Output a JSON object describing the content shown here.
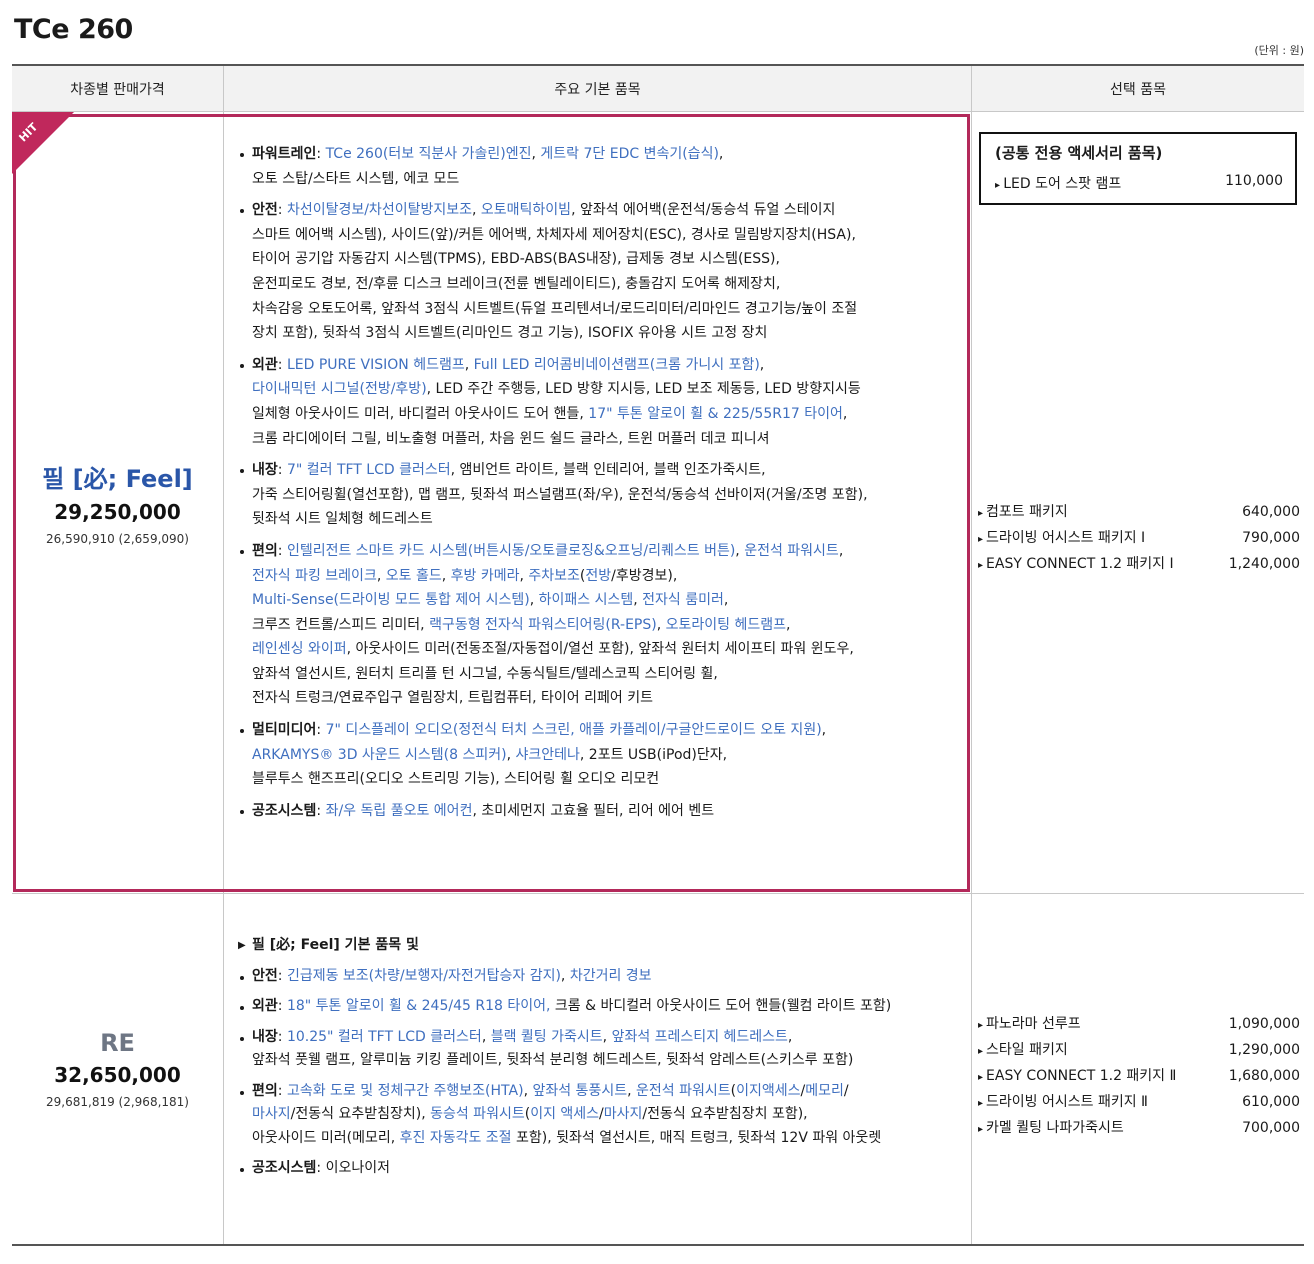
{
  "title": "TCe 260",
  "unit": "(단위 : 원)",
  "headers": [
    "차종별 판매가격",
    "주요 기본 품목",
    "선택 품목"
  ],
  "hit_label": "HIT",
  "trims": [
    {
      "name": "필 [必; Feel]",
      "price": "29,250,000",
      "sub": "26,590,910 (2,659,090)",
      "accessory": {
        "title": "(공통 전용 액세서리 품목)",
        "item": "LED 도어 스팟 램프",
        "price": "110,000"
      },
      "features": [
        {
          "label": "파워트레인",
          "segs": [
            [
              ": ",
              0
            ],
            [
              "TCe 260(터보 직분사 가솔린)엔진",
              1
            ],
            [
              ", ",
              0
            ],
            [
              "게트락 7단 EDC 변속기(습식)",
              1
            ],
            [
              ",",
              0
            ],
            [
              "\n오토 스탑/스타트 시스템, 에코 모드",
              0
            ]
          ]
        },
        {
          "label": "안전",
          "segs": [
            [
              ": ",
              0
            ],
            [
              "차선이탈경보/차선이탈방지보조",
              1
            ],
            [
              ", ",
              0
            ],
            [
              "오토매틱하이빔",
              1
            ],
            [
              ", 앞좌석 에어백(운전석/동승석 듀얼 스테이지\n스마트 에어백 시스템), 사이드(앞)/커튼 에어백, 차체자세 제어장치(ESC), 경사로 밀림방지장치(HSA),\n타이어 공기압 자동감지 시스템(TPMS), EBD-ABS(BAS내장), 급제동 경보 시스템(ESS),\n운전피로도 경보, 전/후륜 디스크 브레이크(전륜 벤틸레이티드), 충돌감지 도어록 해제장치,\n차속감응 오토도어록, 앞좌석 3점식 시트벨트(듀얼 프리텐셔너/로드리미터/리마인드 경고기능/높이 조절\n장치 포함), 뒷좌석 3점식 시트벨트(리마인드 경고 기능), ISOFIX 유아용 시트 고정 장치",
              0
            ]
          ]
        },
        {
          "label": "외관",
          "segs": [
            [
              ": ",
              0
            ],
            [
              "LED PURE VISION  헤드램프",
              1
            ],
            [
              ", ",
              0
            ],
            [
              "Full LED 리어콤비네이션램프(크롬 가니시 포함)",
              1
            ],
            [
              ",\n",
              0
            ],
            [
              "다이내믹턴 시그널(전방/후방)",
              1
            ],
            [
              ", LED 주간 주행등, LED 방향 지시등, LED 보조 제동등, LED 방향지시등\n일체형 아웃사이드 미러, 바디컬러 아웃사이드 도어 핸들, ",
              0
            ],
            [
              "17\" 투톤 알로이 휠 & 225/55R17 타이어",
              1
            ],
            [
              ",\n크롬 라디에이터 그릴, 비노출형 머플러, 차음 윈드 쉴드 글라스, 트윈 머플러 데코 피니셔",
              0
            ]
          ]
        },
        {
          "label": "내장",
          "segs": [
            [
              ": ",
              0
            ],
            [
              "7\" 컬러 TFT LCD 클러스터",
              1
            ],
            [
              ", 앰비언트 라이트, 블랙 인테리어, 블랙 인조가죽시트,\n가죽 스티어링휠(열선포함), 맵 램프, 뒷좌석 퍼스널램프(좌/우), 운전석/동승석 선바이저(거울/조명 포함),\n뒷좌석 시트 일체형 헤드레스트",
              0
            ]
          ]
        },
        {
          "label": "편의",
          "segs": [
            [
              ": ",
              0
            ],
            [
              "인텔리전트 스마트 카드 시스템(버튼시동/오토클로징&오프닝/리퀘스트 버튼)",
              1
            ],
            [
              ", ",
              0
            ],
            [
              "운전석 파워시트",
              1
            ],
            [
              ",\n",
              0
            ],
            [
              "전자식 파킹 브레이크",
              1
            ],
            [
              ", ",
              0
            ],
            [
              "오토 홀드",
              1
            ],
            [
              ", ",
              0
            ],
            [
              "후방 카메라",
              1
            ],
            [
              ", ",
              0
            ],
            [
              "주차보조",
              1
            ],
            [
              "(",
              0
            ],
            [
              "전방",
              1
            ],
            [
              "/후방경보),\n",
              0
            ],
            [
              "Multi-Sense(드라이빙 모드 통합 제어 시스템)",
              1
            ],
            [
              ", ",
              0
            ],
            [
              "하이패스 시스템",
              1
            ],
            [
              ", ",
              0
            ],
            [
              "전자식 룸미러",
              1
            ],
            [
              ",\n크루즈 컨트롤/스피드 리미터, ",
              0
            ],
            [
              "랙구동형 전자식 파워스티어링(R-EPS)",
              1
            ],
            [
              ", ",
              0
            ],
            [
              "오토라이팅 헤드램프",
              1
            ],
            [
              ",\n",
              0
            ],
            [
              "레인센싱 와이퍼",
              1
            ],
            [
              ", 아웃사이드 미러(전동조절/자동접이/열선 포함), 앞좌석 원터치 세이프티 파워 윈도우,\n앞좌석 열선시트, 원터치 트리플 턴 시그널, 수동식틸트/텔레스코픽 스티어링 휠,\n전자식 트렁크/연료주입구 열림장치, 트립컴퓨터, 타이어 리페어 키트",
              0
            ]
          ]
        },
        {
          "label": "멀티미디어",
          "segs": [
            [
              ": ",
              0
            ],
            [
              "7\" 디스플레이 오디오(정전식 터치 스크린, 애플 카플레이/구글안드로이드 오토 지원)",
              1
            ],
            [
              ",\n",
              0
            ],
            [
              "ARKAMYS® 3D 사운드 시스템(8 스피커)",
              1
            ],
            [
              ", ",
              0
            ],
            [
              "샤크안테나",
              1
            ],
            [
              ", 2포트 USB(iPod)단자,\n블루투스 핸즈프리(오디오 스트리밍 기능), 스티어링 휠 오디오 리모컨",
              0
            ]
          ]
        },
        {
          "label": "공조시스템",
          "segs": [
            [
              ": ",
              0
            ],
            [
              "좌/우 독립 풀오토 에어컨",
              1
            ],
            [
              ", 초미세먼지 고효율 필터, 리어 에어 벤트",
              0
            ]
          ]
        }
      ],
      "options": [
        {
          "name": "컴포트 패키지",
          "price": "640,000"
        },
        {
          "name": "드라이빙 어시스트 패키지 Ⅰ",
          "price": "790,000"
        },
        {
          "name": "EASY CONNECT 1.2 패키지 Ⅰ",
          "price": "1,240,000"
        }
      ]
    },
    {
      "name": "RE",
      "price": "32,650,000",
      "sub": "29,681,819 (2,968,181)",
      "base_line": "필 [必; Feel] 기본 품목 및",
      "features": [
        {
          "label": "안전",
          "segs": [
            [
              ": ",
              0
            ],
            [
              "긴급제동 보조(차량/보행자/자전거탑승자 감지)",
              1
            ],
            [
              ", ",
              0
            ],
            [
              "차간거리 경보",
              1
            ]
          ]
        },
        {
          "label": "외관",
          "segs": [
            [
              ": ",
              0
            ],
            [
              "18\" 투톤 알로이 휠 & 245/45 R18 타이어,",
              1
            ],
            [
              " 크롬 & 바디컬러 아웃사이드 도어 핸들(웰컴 라이트 포함)",
              0
            ]
          ]
        },
        {
          "label": "내장",
          "segs": [
            [
              ": ",
              0
            ],
            [
              "10.25\" 컬러 TFT LCD 클러스터",
              1
            ],
            [
              ", ",
              0
            ],
            [
              "블랙 퀼팅 가죽시트",
              1
            ],
            [
              ", ",
              0
            ],
            [
              "앞좌석 프레스티지 헤드레스트",
              1
            ],
            [
              ",\n앞좌석 풋웰 램프, 알루미늄 키킹 플레이트, 뒷좌석 분리형 헤드레스트, 뒷좌석 암레스트(스키스루 포함)",
              0
            ]
          ]
        },
        {
          "label": "편의",
          "segs": [
            [
              ": ",
              0
            ],
            [
              "고속화 도로 및 정체구간 주행보조(HTA)",
              1
            ],
            [
              ", ",
              0
            ],
            [
              "앞좌석 통풍시트",
              1
            ],
            [
              ", ",
              0
            ],
            [
              "운전석 파워시트",
              1
            ],
            [
              "(",
              0
            ],
            [
              "이지액세스",
              1
            ],
            [
              "/",
              0
            ],
            [
              "메모리",
              1
            ],
            [
              "/\n",
              0
            ],
            [
              "마사지",
              1
            ],
            [
              "/전동식 요추받침장치), ",
              0
            ],
            [
              "동승석 파워시트",
              1
            ],
            [
              "(",
              0
            ],
            [
              "이지 액세스",
              1
            ],
            [
              "/",
              0
            ],
            [
              "마사지",
              1
            ],
            [
              "/전동식 요추받침장치 포함),\n아웃사이드 미러(메모리, ",
              0
            ],
            [
              "후진 자동각도 조절",
              1
            ],
            [
              " 포함), 뒷좌석 열선시트, 매직 트렁크, 뒷좌석 12V 파워 아웃렛",
              0
            ]
          ]
        },
        {
          "label": "공조시스템",
          "segs": [
            [
              ": 이오나이저",
              0
            ]
          ]
        }
      ],
      "options": [
        {
          "name": "파노라마 선루프",
          "price": "1,090,000"
        },
        {
          "name": "스타일 패키지",
          "price": "1,290,000"
        },
        {
          "name": "EASY CONNECT 1.2 패키지 Ⅱ",
          "price": "1,680,000"
        },
        {
          "name": "드라이빙 어시스트 패키지 Ⅱ",
          "price": "610,000"
        },
        {
          "name": "카멜 퀼팅 나파가죽시트",
          "price": "700,000"
        }
      ]
    }
  ],
  "colors": {
    "accent_blue": "#3f6fbf",
    "hit_red": "#c0285c",
    "trim_blue": "#2a56a8",
    "trim_gray": "#6e7684"
  }
}
